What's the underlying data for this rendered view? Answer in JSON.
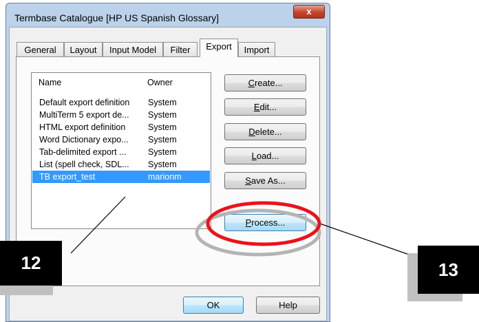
{
  "window": {
    "title": "Termbase Catalogue [HP US Spanish Glossary]",
    "close_glyph": "x"
  },
  "tabs": [
    {
      "label": "General"
    },
    {
      "label": "Layout"
    },
    {
      "label": "Input Model"
    },
    {
      "label": "Filter"
    },
    {
      "label": "Export",
      "active": true
    },
    {
      "label": "Import"
    }
  ],
  "list": {
    "columns": [
      "Name",
      "Owner"
    ],
    "rows": [
      {
        "name": "Default export definition",
        "owner": "System"
      },
      {
        "name": "MultiTerm 5 export de...",
        "owner": "System"
      },
      {
        "name": "HTML export definition",
        "owner": "System"
      },
      {
        "name": "Word Dictionary expo...",
        "owner": "System"
      },
      {
        "name": "Tab-delimited export ...",
        "owner": "System"
      },
      {
        "name": "List (spell check, SDL...",
        "owner": "System"
      },
      {
        "name": "TB export_test",
        "owner": "marionm",
        "selected": true
      }
    ]
  },
  "buttons": {
    "create": {
      "mnemonic": "C",
      "rest": "reate..."
    },
    "edit": {
      "mnemonic": "E",
      "rest": "dit..."
    },
    "delete": {
      "mnemonic": "D",
      "rest": "elete..."
    },
    "load": {
      "mnemonic": "L",
      "rest": "oad..."
    },
    "save_as": {
      "mnemonic": "S",
      "rest": "ave As..."
    },
    "process": {
      "mnemonic": "P",
      "rest": "rocess..."
    },
    "ok": "OK",
    "help": "Help"
  },
  "callouts": {
    "left": "12",
    "right": "13"
  },
  "colors": {
    "selection": "#3399ff",
    "highlight_ellipse": "#e8141b",
    "callout_bg": "#000000"
  }
}
